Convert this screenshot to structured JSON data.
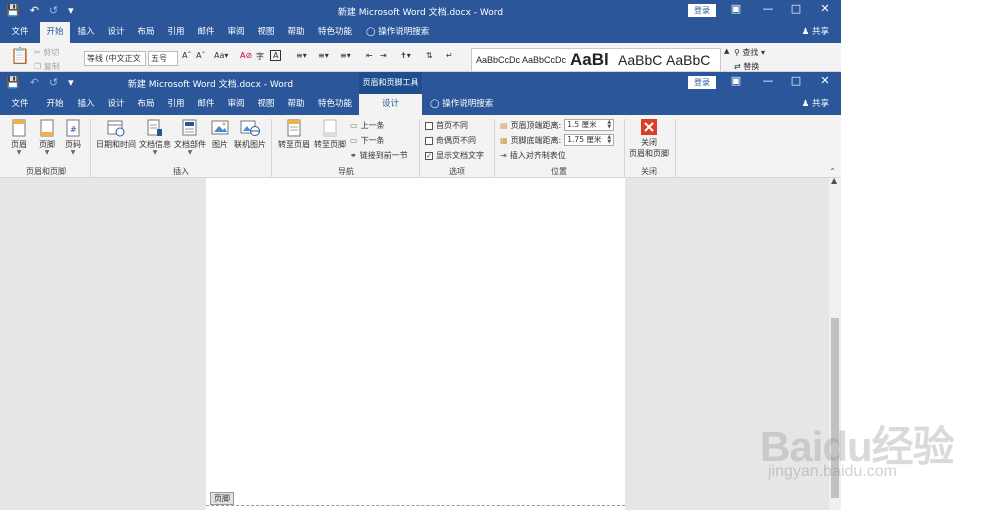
{
  "colors": {
    "title_bar": "#2b579a",
    "ribbon": "#f3f3f3",
    "doc_background": "#e6e6e6",
    "close_header_icon": "#d9402b"
  },
  "back_window": {
    "title": "新建 Microsoft Word 文档.docx - Word",
    "login": "登录",
    "tabs": [
      "文件",
      "开始",
      "插入",
      "设计",
      "布局",
      "引用",
      "邮件",
      "审阅",
      "视图",
      "帮助",
      "特色功能"
    ],
    "active_tab": "开始",
    "tell_me": "操作说明搜索",
    "share": "共享",
    "clipboard": {
      "cut": "剪切",
      "copy": "复制"
    },
    "font_name": "等线 (中文正文",
    "font_size": "五号",
    "styles": [
      "AaBbCcDc",
      "AaBbCcDc",
      "AaBl",
      "AaBbC",
      "AaBbC"
    ],
    "find": "查找",
    "replace": "替换"
  },
  "front_window": {
    "title": "新建 Microsoft Word 文档.docx - Word",
    "context_tool": "页眉和页脚工具",
    "login": "登录",
    "tabs": [
      "文件",
      "开始",
      "插入",
      "设计",
      "布局",
      "引用",
      "邮件",
      "审阅",
      "视图",
      "帮助",
      "特色功能"
    ],
    "active_tab": "设计",
    "tell_me": "操作说明搜索",
    "share": "共享",
    "groups": {
      "header_footer": {
        "label": "页眉和页脚",
        "buttons": [
          "页眉",
          "页脚",
          "页码"
        ]
      },
      "insert": {
        "label": "插入",
        "buttons": [
          "日期和时间",
          "文档信息",
          "文档部件",
          "图片",
          "联机图片"
        ]
      },
      "navigation": {
        "label": "导航",
        "goto_header": "转至页眉",
        "goto_footer": "转至页脚",
        "previous": "上一条",
        "next": "下一条",
        "link_previous": "链接到前一节"
      },
      "options": {
        "label": "选项",
        "items": [
          {
            "text": "首页不同",
            "checked": false
          },
          {
            "text": "奇偶页不同",
            "checked": false
          },
          {
            "text": "显示文档文字",
            "checked": true
          }
        ]
      },
      "position": {
        "label": "位置",
        "header_distance_label": "页眉顶端距离:",
        "header_distance_value": "1.5 厘米",
        "footer_distance_label": "页脚底端距离:",
        "footer_distance_value": "1.75 厘米",
        "insert_tab": "插入对齐制表位"
      },
      "close": {
        "label": "关闭",
        "button_line1": "关闭",
        "button_line2": "页眉和页脚"
      }
    },
    "footer_tag": "页脚"
  },
  "watermark": {
    "brand": "Baidu经验",
    "url": "jingyan.baidu.com"
  }
}
